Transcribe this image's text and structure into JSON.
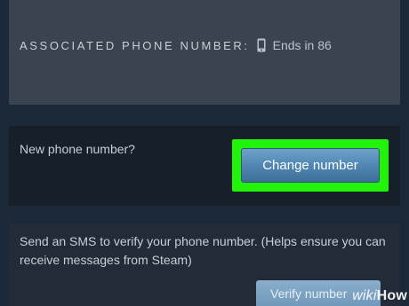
{
  "associated": {
    "label": "ASSOCIATED PHONE NUMBER:",
    "icon": "mobile-phone-icon",
    "ends_text": "Ends in 86"
  },
  "change": {
    "prompt": "New phone number?",
    "button_label": "Change number",
    "highlight_color": "#22f30a"
  },
  "verify": {
    "description": "Send an SMS to verify your phone number. (Helps ensure you can receive messages from Steam)",
    "button_label": "Verify number"
  },
  "watermark": {
    "text_wiki": "wiki",
    "text_how": "How"
  },
  "colors": {
    "background": "#1b2838",
    "button_blue": "#5389b6"
  }
}
